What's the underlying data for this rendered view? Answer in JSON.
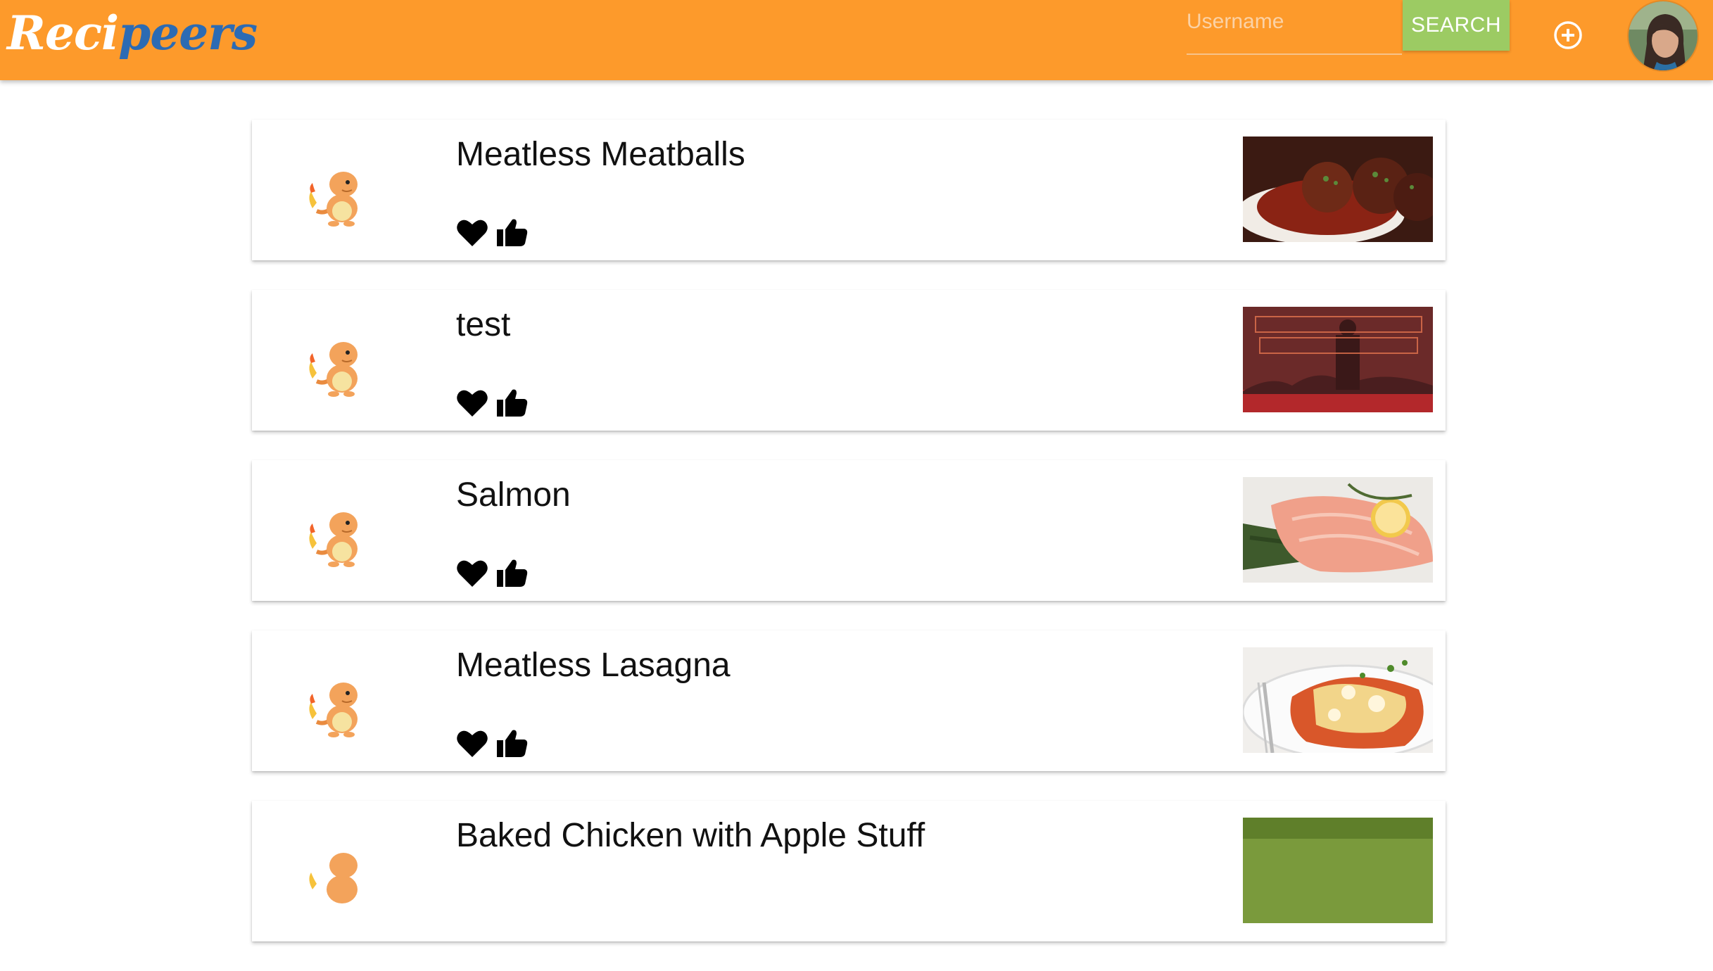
{
  "header": {
    "logo_part1": "Reci",
    "logo_part2": "peers",
    "search": {
      "placeholder": "Username",
      "value": ""
    },
    "search_label": "SEARCH",
    "add_icon": "plus-circle-icon",
    "avatar": "user-avatar"
  },
  "recipes": [
    {
      "title": "Meatless Meatballs",
      "image": "meatballs"
    },
    {
      "title": "test",
      "image": "southern-bastards-poster"
    },
    {
      "title": "Salmon",
      "image": "salmon-with-asparagus"
    },
    {
      "title": "Meatless Lasagna",
      "image": "lasagna"
    },
    {
      "title": "Baked Chicken with Apple Stuff",
      "image": "chicken-dish"
    }
  ],
  "icons": {
    "like": "heart-icon",
    "thumbs": "thumbs-up-icon",
    "author": "charmander-icon"
  },
  "colors": {
    "appbar": "#fd9a2b",
    "search_button": "#9ccb63",
    "logo_accent": "#2c6bb3"
  }
}
